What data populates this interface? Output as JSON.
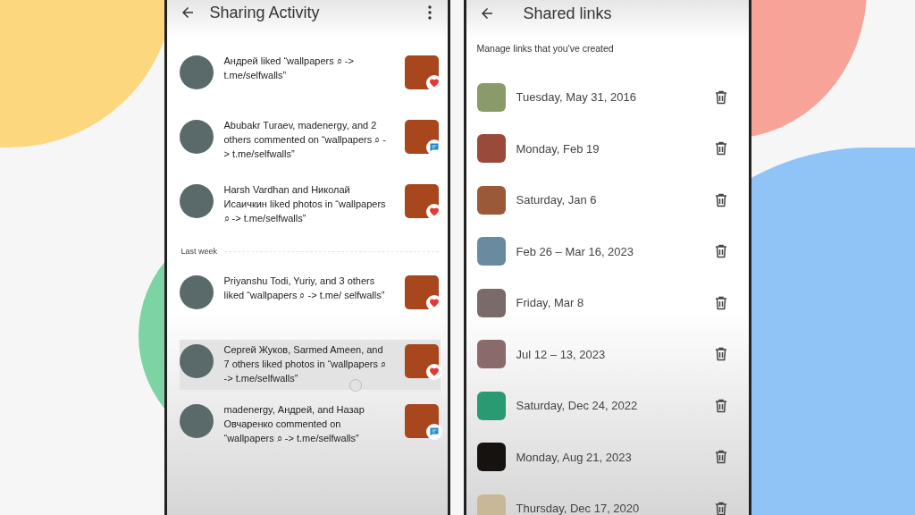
{
  "activity": {
    "title": "Sharing Activity",
    "sections": [
      {
        "items": [
          {
            "text": "Андрей liked “wallpapers ⌕ -> t.me/selfwalls”",
            "kind": "like",
            "pressed": false
          },
          {
            "text": "Abubakr Turaev, madenergy, and 2 others commented on “wallpapers ⌕ -> t.me/selfwalls”",
            "kind": "comment",
            "pressed": false
          },
          {
            "text": "Harsh Vardhan and Николай Исаичкин liked photos in “wallpapers ⌕ -> t.me/selfwalls”",
            "kind": "like",
            "pressed": false
          }
        ]
      },
      {
        "header": "Last week",
        "items": [
          {
            "text": "Priyanshu Todi, Yuriy, and 3 others liked “wallpapers ⌕ -> t.me/ selfwalls”",
            "kind": "like",
            "pressed": false
          },
          {
            "text": "Сергей Жуков, Sarmed Ameen, and 7 others liked photos in “wallpapers ⌕ -> t.me/selfwalls”",
            "kind": "like",
            "pressed": true
          },
          {
            "text": "madenergy, Андрей, and Назар Овчаренко commented on “wallpapers ⌕ -> t.me/selfwalls”",
            "kind": "comment",
            "pressed": false
          }
        ]
      }
    ]
  },
  "shared_links": {
    "title": "Shared links",
    "subtitle": "Manage links that you've created",
    "links": [
      {
        "date": "Tuesday, May 31, 2016",
        "color": "#8a9a6a"
      },
      {
        "date": "Monday, Feb 19",
        "color": "#9a4a3a"
      },
      {
        "date": "Saturday, Jan 6",
        "color": "#9a5a3a"
      },
      {
        "date": "Feb 26 – Mar 16, 2023",
        "color": "#6a8aa0"
      },
      {
        "date": "Friday, Mar 8",
        "color": "#7a6a6a"
      },
      {
        "date": "Jul 12 – 13, 2023",
        "color": "#8a6a6a"
      },
      {
        "date": "Saturday, Dec 24, 2022",
        "color": "#2a9a72"
      },
      {
        "date": "Monday, Aug 21, 2023",
        "color": "#151210"
      },
      {
        "date": "Thursday, Dec 17, 2020",
        "color": "#c8b898"
      }
    ]
  }
}
